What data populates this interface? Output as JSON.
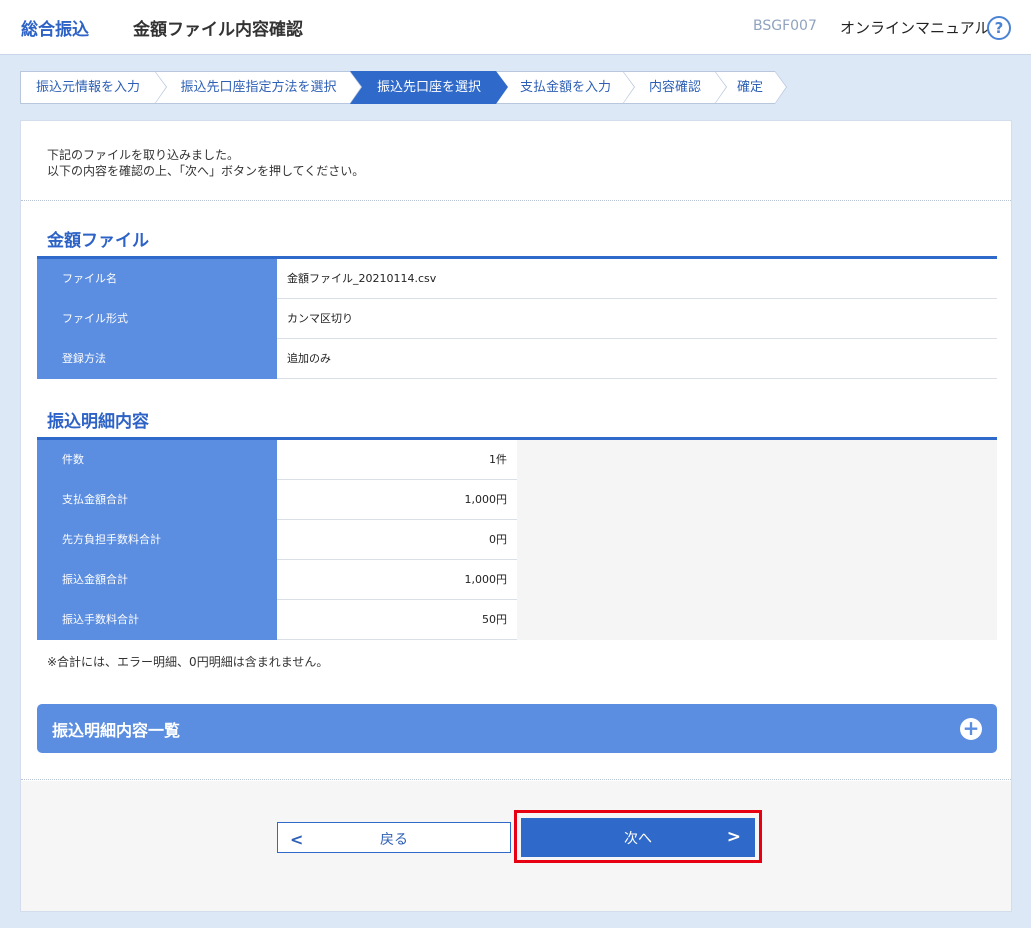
{
  "header": {
    "app_title": "総合振込",
    "page_title": "金額ファイル内容確認",
    "screen_id": "BSGF007",
    "manual_link": "オンラインマニュアル",
    "help_icon_glyph": "?"
  },
  "steps": [
    {
      "label": "振込元情報を入力",
      "current": false
    },
    {
      "label": "振込先口座指定方法を選択",
      "current": false
    },
    {
      "label": "振込先口座を選択",
      "current": true
    },
    {
      "label": "支払金額を入力",
      "current": false
    },
    {
      "label": "内容確認",
      "current": false
    },
    {
      "label": "確定",
      "current": false
    }
  ],
  "intro": {
    "line1": "下記のファイルを取り込みました。",
    "line2": "以下の内容を確認の上、「次へ」ボタンを押してください。"
  },
  "amount_file": {
    "title": "金額ファイル",
    "rows": [
      {
        "label": "ファイル名",
        "value": "金額ファイル_20210114.csv"
      },
      {
        "label": "ファイル形式",
        "value": "カンマ区切り"
      },
      {
        "label": "登録方法",
        "value": "追加のみ"
      }
    ]
  },
  "transfer_detail": {
    "title": "振込明細内容",
    "rows": [
      {
        "label": "件数",
        "value": "1件"
      },
      {
        "label": "支払金額合計",
        "value": "1,000円"
      },
      {
        "label": "先方負担手数料合計",
        "value": "0円"
      },
      {
        "label": "振込金額合計",
        "value": "1,000円"
      },
      {
        "label": "振込手数料合計",
        "value": "50円"
      }
    ],
    "note": "※合計には、エラー明細、0円明細は含まれません。"
  },
  "accordion": {
    "title": "振込明細内容一覧",
    "icon": "plus-icon",
    "icon_glyph": "+"
  },
  "buttons": {
    "back_label": "戻る",
    "back_glyph": "<",
    "next_label": "次へ",
    "next_glyph": ">"
  },
  "colors": {
    "brand_blue": "#2f69c9",
    "header_cell_blue": "#5b8de0",
    "highlight_red": "#e60012"
  }
}
